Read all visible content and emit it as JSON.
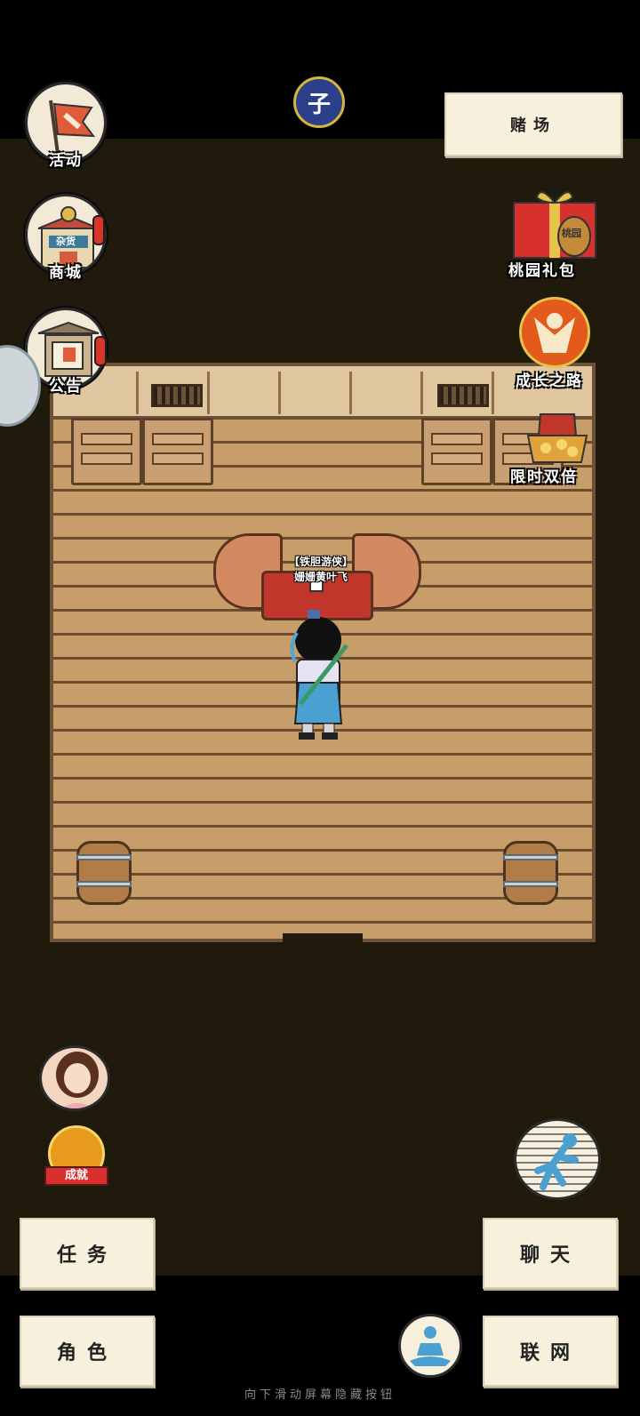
{
  "time_badge": {
    "text": "子"
  },
  "left_menu": [
    {
      "key": "activity",
      "label": "活动",
      "icon": "flag-icon"
    },
    {
      "key": "shop",
      "label": "商城",
      "icon": "shop-icon",
      "badge_text": "杂货"
    },
    {
      "key": "notice",
      "label": "公告",
      "icon": "notice-board-icon"
    }
  ],
  "right_menu": [
    {
      "key": "gift",
      "label": "桃园礼包",
      "icon": "gift-box-icon",
      "tag_text": "桃园"
    },
    {
      "key": "growth",
      "label": "成长之路",
      "icon": "growth-icon"
    },
    {
      "key": "double",
      "label": "限时双倍",
      "icon": "treasure-chest-icon"
    }
  ],
  "top_right_button": {
    "label": "赌场"
  },
  "npc": {
    "title": "【铁胆游侠】",
    "name": "姗姗黄叶飞"
  },
  "achievement": {
    "label": "成就"
  },
  "buttons": {
    "task": "任务",
    "chat": "聊天",
    "role": "角色",
    "network": "联网"
  },
  "hint": "向下滑动屏幕隐藏按钮",
  "colors": {
    "background": "#1f1a0b",
    "paper": "#f6f0dc",
    "floor": "#c19664",
    "accent_red": "#d6352b"
  }
}
